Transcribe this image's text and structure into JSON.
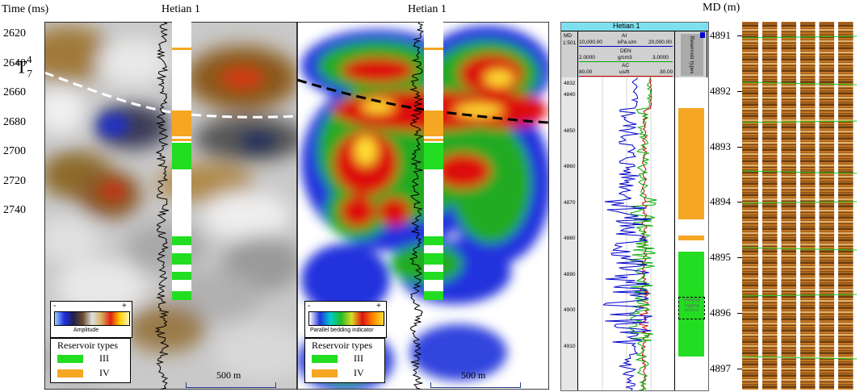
{
  "left_axis": {
    "label": "Time (ms)",
    "ticks": [
      "2620",
      "2640",
      "2660",
      "2680",
      "2700",
      "2720",
      "2740"
    ]
  },
  "panels": {
    "amplitude": {
      "title": "Hetian 1",
      "horizon_label": "T",
      "horizon_sub": "7",
      "horizon_sup": "4",
      "colorbar_label": "Amplitude",
      "colorbar_min": "-",
      "colorbar_max": "+",
      "scale_label": "500 m"
    },
    "parallel_bedding": {
      "title": "Hetian 1",
      "colorbar_label": "Parallel bedding indicator",
      "colorbar_min": "-",
      "colorbar_max": "+",
      "scale_label": "500 m"
    }
  },
  "reservoir_legend": {
    "title": "Reservoir types",
    "items": [
      {
        "label": "III",
        "color": "#22dd22"
      },
      {
        "label": "IV",
        "color": "#f5a623"
      }
    ]
  },
  "well_log": {
    "title": "Hetian 1",
    "md_label": "MD",
    "scale": "1:501",
    "curves": [
      {
        "name": "AI",
        "min": "10,000.00",
        "unit": "kPa.s/m",
        "max": "20,000.00",
        "color": "#0000cc"
      },
      {
        "name": "DEN",
        "min": "2.0000",
        "unit": "g/cm3",
        "max": "3.0000",
        "color": "#00aa00"
      },
      {
        "name": "AC",
        "min": "80.00",
        "unit": "us/ft",
        "max": "30.00",
        "color": "#cc0000"
      }
    ],
    "reservoir_header": "Reservoir types",
    "depth_ticks": [
      "4832",
      "4840",
      "4850",
      "4860",
      "4870",
      "4880",
      "4890",
      "4900",
      "4910"
    ],
    "imaging_label": "Imaging logging section"
  },
  "image_log": {
    "axis_label": "MD (m)",
    "ticks": [
      "4891",
      "4892",
      "4893",
      "4894",
      "4895",
      "4896",
      "4897"
    ]
  },
  "colors": {
    "reservoir_III": "#22dd22",
    "reservoir_IV": "#f5a623",
    "ai_curve": "#0000cc",
    "den_curve": "#00aa00",
    "ac_curve": "#cc0000"
  }
}
